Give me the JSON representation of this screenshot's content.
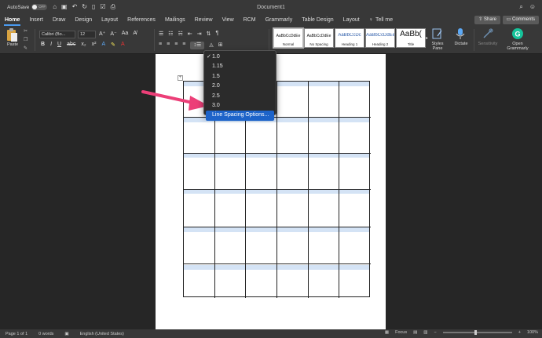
{
  "titlebar": {
    "autosave_label": "AutoSave",
    "autosave_state": "OFF",
    "document_title": "Document1",
    "qa_icons": [
      "home-icon",
      "save-icon",
      "undo-icon",
      "redo-icon",
      "new-doc-icon",
      "check-icon",
      "print-icon"
    ]
  },
  "tabs": [
    "Home",
    "Insert",
    "Draw",
    "Design",
    "Layout",
    "References",
    "Mailings",
    "Review",
    "View",
    "RCM",
    "Grammarly",
    "Table Design",
    "Layout"
  ],
  "active_tab": "Home",
  "tell_me": "Tell me",
  "share_label": "Share",
  "comments_label": "Comments",
  "ribbon": {
    "paste_label": "Paste",
    "font_name": "Calibri (Bo...",
    "font_size": "12",
    "styles": [
      {
        "sample": "AaBbCcDdEe",
        "name": "Normal"
      },
      {
        "sample": "AaBbCcDdEe",
        "name": "No Spacing"
      },
      {
        "sample": "AaBbCcDc",
        "name": "Heading 1"
      },
      {
        "sample": "AaBbCcDdEe",
        "name": "Heading 2"
      },
      {
        "sample": "AaBb(",
        "name": "Title"
      }
    ],
    "styles_pane_label": "Styles\nPane",
    "dictate_label": "Dictate",
    "sensitivity_label": "Sensitivity",
    "grammarly_label": "Open\nGrammarly"
  },
  "line_spacing_menu": {
    "items": [
      "1.0",
      "1.15",
      "1.5",
      "2.0",
      "2.5",
      "3.0",
      "Line Spacing Options..."
    ],
    "checked": "1.0",
    "highlighted": "Line Spacing Options..."
  },
  "status": {
    "page": "Page 1 of 1",
    "words": "0 words",
    "language": "English (United States)",
    "focus": "Focus",
    "zoom": "100%"
  },
  "colors": {
    "accent": "#1d63c9",
    "arrow": "#ec3f78",
    "grammarly": "#15c39a"
  }
}
